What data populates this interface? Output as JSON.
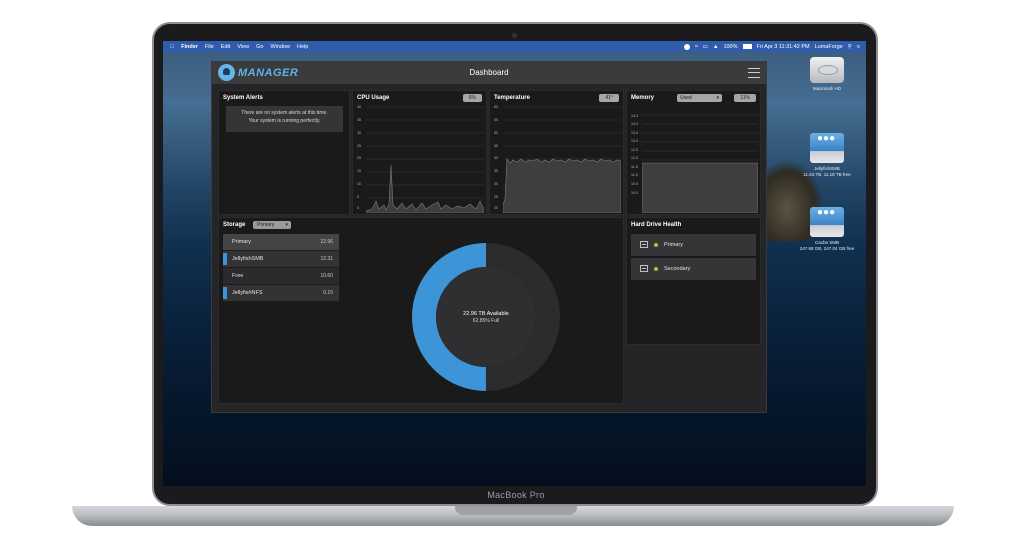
{
  "menubar": {
    "items": [
      "Finder",
      "File",
      "Edit",
      "View",
      "Go",
      "Window",
      "Help"
    ],
    "status": {
      "battery": "100%",
      "datetime": "Fri Apr 3 11:31:42 PM",
      "user": "LumaForge"
    }
  },
  "desktop_icons": [
    {
      "label": "Macintosh HD",
      "icon": "hard-drive-icon"
    },
    {
      "label": "JellyfishSMB",
      "sublabel": "11.63 TB, 11.18 TB free",
      "icon": "network-drive-icon"
    },
    {
      "label": "Cache SMB",
      "sublabel": "247.68 GB, 247.04 GB free",
      "icon": "network-drive-icon"
    }
  ],
  "app": {
    "logo_text": "MANAGER",
    "title": "Dashboard",
    "panels": {
      "alerts": {
        "title": "System Alerts",
        "message_line1": "There are no system alerts at this time.",
        "message_line2": "Your system is running perfectly."
      },
      "cpu": {
        "title": "CPU Usage",
        "badge": "6%",
        "y_ticks": [
          "40",
          "35",
          "30",
          "25",
          "20",
          "15",
          "10",
          "5",
          "0"
        ]
      },
      "temperature": {
        "title": "Temperature",
        "badge": "41°",
        "y_ticks": [
          "60",
          "55",
          "50",
          "45",
          "40",
          "35",
          "30",
          "25",
          "20"
        ]
      },
      "memory": {
        "title": "Memory",
        "select_value": "Used",
        "badge": "11%",
        "y_ticks": [
          "14.3",
          "14.0",
          "13.5",
          "13.0",
          "12.5",
          "12.0",
          "11.5",
          "11.0",
          "10.5",
          "10.0"
        ]
      },
      "storage": {
        "title": "Storage",
        "select_value": "Primary",
        "rows": [
          {
            "name": "Primary",
            "value": "22.96",
            "bar": false
          },
          {
            "name": "JellyfishSMB",
            "value": "12.31",
            "bar": true
          },
          {
            "name": "Free",
            "value": "10.60",
            "bar": false
          },
          {
            "name": "JellyfishNFS",
            "value": "0.15",
            "bar": true
          }
        ],
        "available": "22.96 TB Available",
        "full": "62.85% Full",
        "used_fraction": 0.5
      },
      "hdd": {
        "title": "Hard Drive Health",
        "drives": [
          {
            "name": "Primary",
            "status_color": "#99cc33"
          },
          {
            "name": "Secondary",
            "status_color": "#99cc33"
          }
        ]
      }
    }
  },
  "laptop_label": "MacBook Pro",
  "colors": {
    "accent": "#3d94d6",
    "menubar": "#2f5dab",
    "healthy": "#99cc33"
  }
}
